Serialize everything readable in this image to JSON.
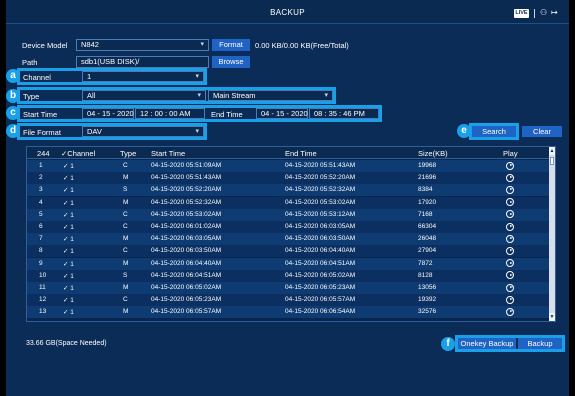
{
  "window": {
    "title": "BACKUP",
    "live_label": "LIVE",
    "user_icon": "user-icon",
    "logout_icon": "logout-icon"
  },
  "device": {
    "model_label": "Device Model",
    "model_value": "N842",
    "format_label": "Format",
    "capacity_text": "0.00 KB/0.00 KB(Free/Total)",
    "path_label": "Path",
    "path_value": "sdb1(USB DISK)/",
    "browse_label": "Browse"
  },
  "filters": {
    "channel_label": "Channel",
    "channel_value": "1",
    "type_label": "Type",
    "type_value": "All",
    "stream_value": "Main Stream",
    "start_time_label": "Start Time",
    "start_date": "04 - 15 - 2020",
    "start_time": "12 : 00 : 00 AM",
    "end_time_label": "End Time",
    "end_date": "04 - 15 - 2020",
    "end_time": "08 : 35 : 46 PM",
    "file_format_label": "File Format",
    "file_format_value": "DAV",
    "search_label": "Search",
    "clear_label": "Clear"
  },
  "badges": [
    "a",
    "b",
    "c",
    "d",
    "e",
    "f"
  ],
  "table": {
    "headers": {
      "count": "244",
      "channel": "✓Channel",
      "type": "Type",
      "start": "Start Time",
      "end": "End Time",
      "size": "Size(KB)",
      "play": "Play"
    },
    "rows": [
      {
        "idx": "1",
        "ch": "✓ 1",
        "type": "C",
        "start": "04-15-2020 05:51:09AM",
        "end": "04-15-2020 05:51:43AM",
        "size": "19968"
      },
      {
        "idx": "2",
        "ch": "✓ 1",
        "type": "M",
        "start": "04-15-2020 05:51:43AM",
        "end": "04-15-2020 05:52:20AM",
        "size": "21696"
      },
      {
        "idx": "3",
        "ch": "✓ 1",
        "type": "S",
        "start": "04-15-2020 05:52:20AM",
        "end": "04-15-2020 05:52:32AM",
        "size": "8384"
      },
      {
        "idx": "4",
        "ch": "✓ 1",
        "type": "M",
        "start": "04-15-2020 05:52:32AM",
        "end": "04-15-2020 05:53:02AM",
        "size": "17920"
      },
      {
        "idx": "5",
        "ch": "✓ 1",
        "type": "C",
        "start": "04-15-2020 05:53:02AM",
        "end": "04-15-2020 05:53:12AM",
        "size": "7168"
      },
      {
        "idx": "6",
        "ch": "✓ 1",
        "type": "C",
        "start": "04-15-2020 06:01:02AM",
        "end": "04-15-2020 06:03:05AM",
        "size": "66304"
      },
      {
        "idx": "7",
        "ch": "✓ 1",
        "type": "M",
        "start": "04-15-2020 06:03:05AM",
        "end": "04-15-2020 06:03:50AM",
        "size": "26048"
      },
      {
        "idx": "8",
        "ch": "✓ 1",
        "type": "C",
        "start": "04-15-2020 06:03:50AM",
        "end": "04-15-2020 06:04:40AM",
        "size": "27904"
      },
      {
        "idx": "9",
        "ch": "✓ 1",
        "type": "M",
        "start": "04-15-2020 06:04:40AM",
        "end": "04-15-2020 06:04:51AM",
        "size": "7872"
      },
      {
        "idx": "10",
        "ch": "✓ 1",
        "type": "S",
        "start": "04-15-2020 06:04:51AM",
        "end": "04-15-2020 06:05:02AM",
        "size": "8128"
      },
      {
        "idx": "11",
        "ch": "✓ 1",
        "type": "M",
        "start": "04-15-2020 06:05:02AM",
        "end": "04-15-2020 06:05:23AM",
        "size": "13056"
      },
      {
        "idx": "12",
        "ch": "✓ 1",
        "type": "C",
        "start": "04-15-2020 06:05:23AM",
        "end": "04-15-2020 06:05:57AM",
        "size": "19392"
      },
      {
        "idx": "13",
        "ch": "✓ 1",
        "type": "M",
        "start": "04-15-2020 06:05:57AM",
        "end": "04-15-2020 06:06:54AM",
        "size": "32576"
      }
    ]
  },
  "footer": {
    "space_needed": "33.66 GB(Space Needed)",
    "onekey_backup_label": "Onekey Backup",
    "backup_label": "Backup"
  },
  "colors": {
    "background": "#0b2c57",
    "accent_button": "#1f63c4",
    "highlight_cyan": "#1aa0e8",
    "row_alt": "#0e3b72"
  }
}
